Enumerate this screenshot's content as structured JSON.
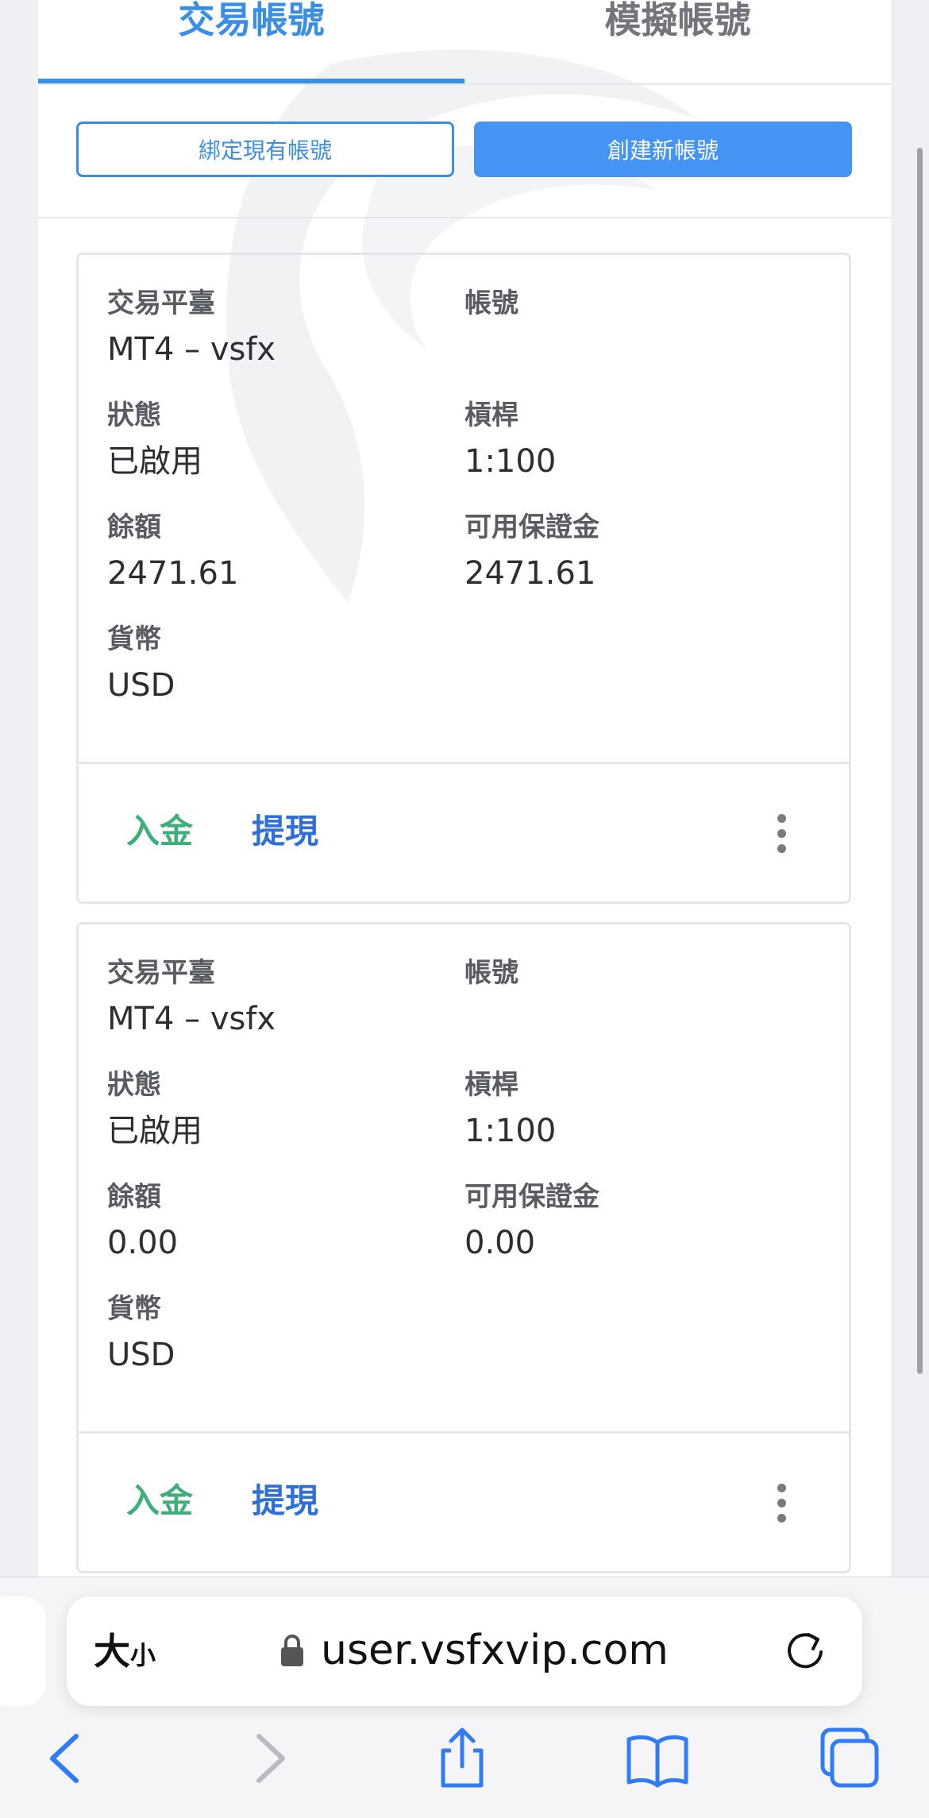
{
  "tabs": {
    "trading": "交易帳號",
    "demo": "模擬帳號"
  },
  "actions_top": {
    "bind_existing": "綁定現有帳號",
    "create_new": "創建新帳號"
  },
  "labels": {
    "platform": "交易平臺",
    "account": "帳號",
    "status": "狀態",
    "leverage": "槓桿",
    "balance": "餘額",
    "free_margin": "可用保證金",
    "currency": "貨幣",
    "deposit": "入金",
    "withdraw": "提現"
  },
  "accounts": [
    {
      "platform": "MT4 – vsfx",
      "account": "",
      "status": "已啟用",
      "leverage": "1:100",
      "balance": "2471.61",
      "free_margin": "2471.61",
      "currency": "USD"
    },
    {
      "platform": "MT4 – vsfx",
      "account": "",
      "status": "已啟用",
      "leverage": "1:100",
      "balance": "0.00",
      "free_margin": "0.00",
      "currency": "USD"
    }
  ],
  "browser": {
    "text_size": "大",
    "text_size_small": "小",
    "url": "user.vsfxvip.com"
  },
  "icons": {
    "lock": "lock-icon",
    "reload": "reload-icon",
    "back": "back-icon",
    "forward": "forward-icon",
    "share": "share-icon",
    "bookmarks": "bookmarks-icon",
    "tabs": "tabs-icon"
  },
  "colors": {
    "accent": "#3b8ee6",
    "deposit": "#3fae7a",
    "withdraw": "#2f6fd9",
    "ios_blue": "#2f7cf6"
  }
}
